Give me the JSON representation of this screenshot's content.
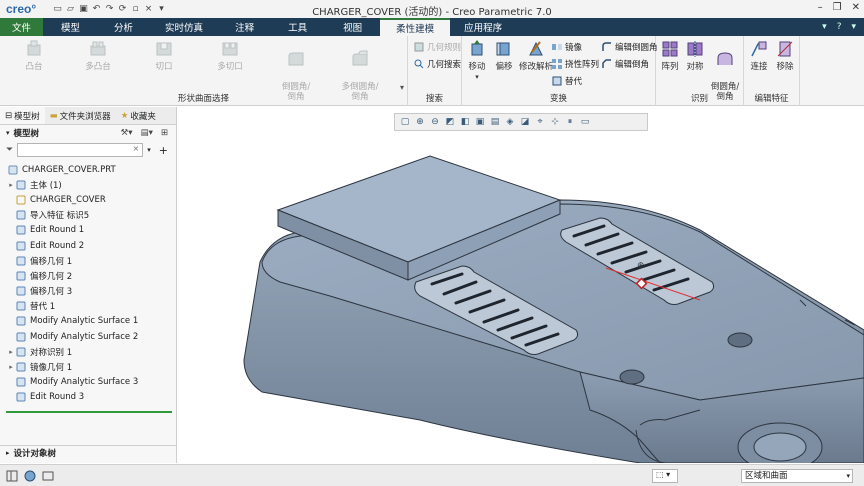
{
  "app": {
    "logo": "creo°",
    "title": "CHARGER_COVER (活动的) - Creo Parametric 7.0"
  },
  "menu": {
    "tabs": [
      "文件",
      "模型",
      "分析",
      "实时仿真",
      "注释",
      "工具",
      "视图",
      "柔性建模",
      "应用程序"
    ],
    "active_tab": "柔性建模"
  },
  "ribbon": {
    "shape_group": {
      "name": "形状曲面选择",
      "buttons": [
        "凸台",
        "多凸台",
        "切口",
        "多切口",
        "倒圆角/\n倒角",
        "多倒圆角/\n倒角"
      ]
    },
    "search_group": {
      "name": "搜索",
      "buttons": [
        "几何规则",
        "几何搜索"
      ]
    },
    "transform_group": {
      "name": "变换",
      "big": [
        "移动",
        "偏移",
        "修改解析"
      ],
      "small": [
        "镜像",
        "挠性阵列",
        "替代",
        "编辑倒圆角",
        "编辑倒角"
      ]
    },
    "recognize_group": {
      "name": "识别",
      "big": [
        "阵列",
        "对称",
        "倒圆角/\n倒角"
      ]
    },
    "edit_group": {
      "name": "编辑特征",
      "big": [
        "连接",
        "移除"
      ]
    }
  },
  "navigator": {
    "tabs": [
      "模型树",
      "文件夹浏览器",
      "收藏夹"
    ],
    "tree_header": "模型树",
    "filter_placeholder": "",
    "items": [
      {
        "label": "CHARGER_COVER.PRT",
        "expandable": false,
        "indent": 0
      },
      {
        "label": "主体 (1)",
        "expandable": true,
        "indent": 1
      },
      {
        "label": "CHARGER_COVER",
        "expandable": false,
        "indent": 1
      },
      {
        "label": "导入特征 标识5",
        "expandable": false,
        "indent": 1
      },
      {
        "label": "Edit Round 1",
        "expandable": false,
        "indent": 1
      },
      {
        "label": "Edit Round 2",
        "expandable": false,
        "indent": 1
      },
      {
        "label": "偏移几何 1",
        "expandable": false,
        "indent": 1
      },
      {
        "label": "偏移几何 2",
        "expandable": false,
        "indent": 1
      },
      {
        "label": "偏移几何 3",
        "expandable": false,
        "indent": 1
      },
      {
        "label": "替代 1",
        "expandable": false,
        "indent": 1
      },
      {
        "label": "Modify Analytic Surface 1",
        "expandable": false,
        "indent": 1
      },
      {
        "label": "Modify Analytic Surface 2",
        "expandable": false,
        "indent": 1
      },
      {
        "label": "对称识别 1",
        "expandable": true,
        "indent": 1
      },
      {
        "label": "镜像几何 1",
        "expandable": true,
        "indent": 1
      },
      {
        "label": "Modify Analytic Surface 3",
        "expandable": false,
        "indent": 1
      },
      {
        "label": "Edit Round 3",
        "expandable": false,
        "indent": 1
      }
    ],
    "design_tree": "设计对象树"
  },
  "status": {
    "selection_filter": "区域和曲面"
  },
  "colors": {
    "menubar": "#1f3c56",
    "file_tab": "#2f7a3a",
    "model_body": "#8a9bb0",
    "model_edge": "#2d3540"
  }
}
